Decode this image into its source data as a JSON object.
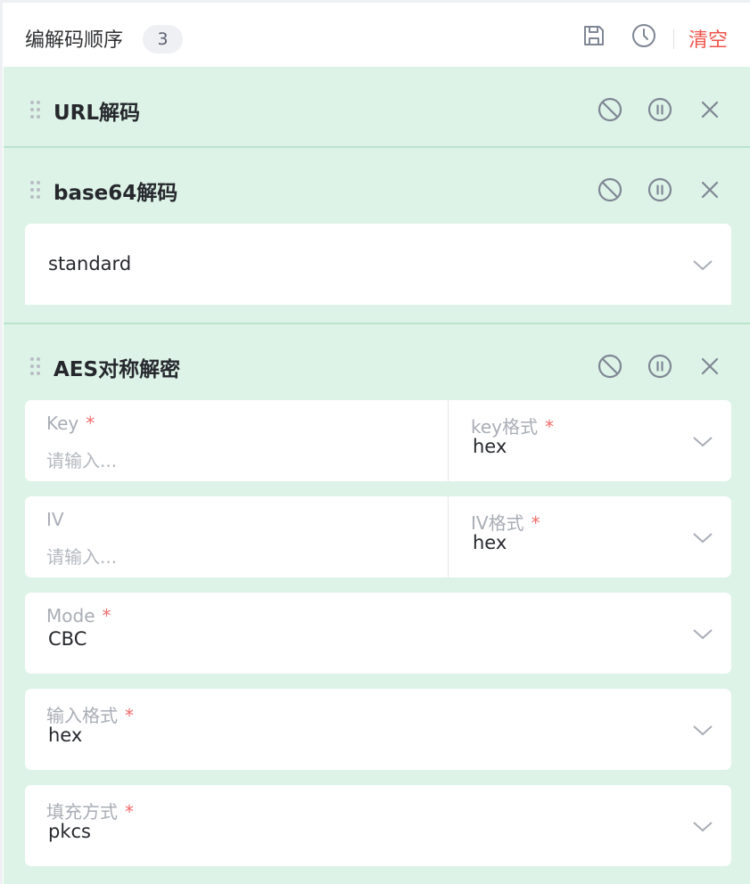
{
  "header": {
    "title": "编解码顺序",
    "count": "3",
    "save_icon": "save-icon",
    "history_icon": "clock-icon",
    "clear_label": "清空"
  },
  "colors": {
    "panel_bg": "#ddf3e7",
    "divider": "#b9e3cd",
    "danger": "#f0534a",
    "required": "#f56c6c",
    "icon": "#7f8694"
  },
  "steps": [
    {
      "title": "URL解码",
      "icons": [
        "disable-icon",
        "pause-icon",
        "close-icon"
      ]
    },
    {
      "title": "base64解码",
      "icons": [
        "disable-icon",
        "pause-icon",
        "close-icon"
      ],
      "variant": {
        "value": "standard"
      }
    },
    {
      "title": "AES对称解密",
      "icons": [
        "disable-icon",
        "pause-icon",
        "close-icon"
      ],
      "key": {
        "label": "Key",
        "required": "*",
        "placeholder": "请输入..."
      },
      "key_format": {
        "label": "key格式",
        "required": "*",
        "value": "hex"
      },
      "iv": {
        "label": "IV",
        "placeholder": "请输入..."
      },
      "iv_format": {
        "label": "IV格式",
        "required": "*",
        "value": "hex"
      },
      "mode": {
        "label": "Mode",
        "required": "*",
        "value": "CBC"
      },
      "input_format": {
        "label": "输入格式",
        "required": "*",
        "value": "hex"
      },
      "padding": {
        "label": "填充方式",
        "required": "*",
        "value": "pkcs"
      }
    }
  ]
}
